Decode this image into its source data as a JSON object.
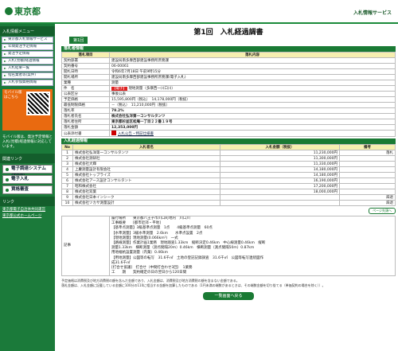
{
  "header": {
    "logo": "東京都",
    "system": "入札情報サービス"
  },
  "side": {
    "section1": "入札情報メニュー",
    "menu": [
      "東京都入札情報サービス",
      "年間発注予定情報",
      "発注予定情報",
      "入札(見積)経過情報",
      "入札結果一覧",
      "指名業者等(案件)",
      "入札参加資格情報"
    ],
    "mobile_title": "モバイル版はこちら",
    "mobile_body": "モバイル版は、発注予定情報と入札(見積)経過情報に対応しています。",
    "section2": "関連リンク",
    "big": [
      "電子調達システム(TOP)",
      "電子入札",
      "資格審査"
    ],
    "section3": "リンク",
    "tiny": [
      "東京都電子自治体共同運営",
      "東京都公式ホームページ"
    ]
  },
  "page": {
    "title": "第1回　入札経過調書",
    "round": "第1回"
  },
  "info": {
    "section": "落札者情報",
    "head_key": "落札項目",
    "head_val": "落札内容",
    "rows": [
      {
        "k": "契約部署",
        "v": "建設局南多摩西部建設事務所庶務課"
      },
      {
        "k": "契約番号",
        "v": "06-00061"
      },
      {
        "k": "開札日時",
        "v": "令和6年7月18日 午前9時15分"
      },
      {
        "k": "開札場所",
        "v": "建設局南多摩西部建設事務所庶務課(電子入札)"
      },
      {
        "k": "業種",
        "v": "測量"
      },
      {
        "k": "件　名",
        "badge": "【電子】",
        "v": "現地測量（多摩西一川口川）"
      },
      {
        "k": "公表区分",
        "v": "事後公表"
      },
      {
        "k": "予定価格",
        "v": "15,595,800円（税込）　14,178,000円（税抜）"
      },
      {
        "k": "最低制限価格",
        "v": "－（税込）　11,210,000円（税抜）"
      },
      {
        "k": "落札率",
        "v": "79.2%"
      },
      {
        "k": "落札者氏名",
        "v": "株式会社弘洋第一コンサルタンツ"
      },
      {
        "k": "落札者住所",
        "v": "東京都杉並区松庵一丁目２２番１９号"
      },
      {
        "k": "落札金額",
        "v": "12,353,000円"
      },
      {
        "k": "公表添付書",
        "v": "入札公告・特記仕様書"
      }
    ]
  },
  "bids": {
    "section": "入札経過情報",
    "cols": [
      "No",
      "入札者名",
      "入札金額（税抜）",
      "備考"
    ],
    "rows": [
      {
        "no": "1",
        "name": "株式会社弘洋第一コンサルタンツ",
        "amt": "11,230,000円",
        "note": "落札"
      },
      {
        "no": "2",
        "name": "株式会社測研社",
        "amt": "11,300,000円",
        "note": ""
      },
      {
        "no": "3",
        "name": "株式会社大輝",
        "amt": "11,330,000円",
        "note": ""
      },
      {
        "no": "4",
        "name": "上慶測量設計有限会社",
        "amt": "14,180,000円",
        "note": ""
      },
      {
        "no": "5",
        "name": "株式会社トップライズ",
        "amt": "14,180,000円",
        "note": ""
      },
      {
        "no": "6",
        "name": "株式会社アース設計コンサルタント",
        "amt": "16,190,000円",
        "note": ""
      },
      {
        "no": "7",
        "name": "昭和株式会社",
        "amt": "17,200,000円",
        "note": ""
      },
      {
        "no": "8",
        "name": "株式会社双葉",
        "amt": "18,000,000円",
        "note": ""
      },
      {
        "no": "9",
        "name": "株式会社日本インシーク",
        "amt": "",
        "note": "辞退"
      },
      {
        "no": "10",
        "name": "株式会社ツカサ測量設計",
        "amt": "",
        "note": "辞退"
      }
    ],
    "more": "ページ先頭へ"
  },
  "memo": {
    "key": "記事",
    "lines": [
      "履行場所　　東京都八王子市川口町地内　川口川",
      "工事概要　　[都市近郊・平地]",
      "【基準点測量】3級基準点測量　1点　　4級基準点測量　60点",
      "【水準測量】3級水準測量　2.6km　　水準点設置　2点",
      "【現地測量】現地測量(0.066km²)　一式",
      "【路線測量】作業計画1業務　現地踏査1.33km　縦断決定0.46km　中心線測量0.46km　縦断",
      "測量1.33km　横断測量（測点間隔20m）0.46km　横断測量（測点間隔50m）0.87km",
      "用地幅杭設置測量（内業）0.46km",
      "【用地測量】公図等の転写　31.6千㎡　土地の登記記録調査　31.6千㎡　公図等転写連続図作",
      "成31.6千㎡",
      "[打合せ協議]　打合せ（中間打合わせ3回）　1業務",
      "工　　期　　契約確定の日の翌日から120日間"
    ]
  },
  "footer": {
    "note1": "予定価格は消費税及び地方消費税の額を含んだ金額であり、入札金額は、消費税及び地方消費税の額を含まない金額である。",
    "note2": "落札金額は、入札金額に記載している金額に100分の110に相当する金額を加算したものである（1円未満の端数があるときは、その端数金額を切り捨てる（単価契約の場合を除く））。",
    "back": "一覧画面へ戻る"
  }
}
